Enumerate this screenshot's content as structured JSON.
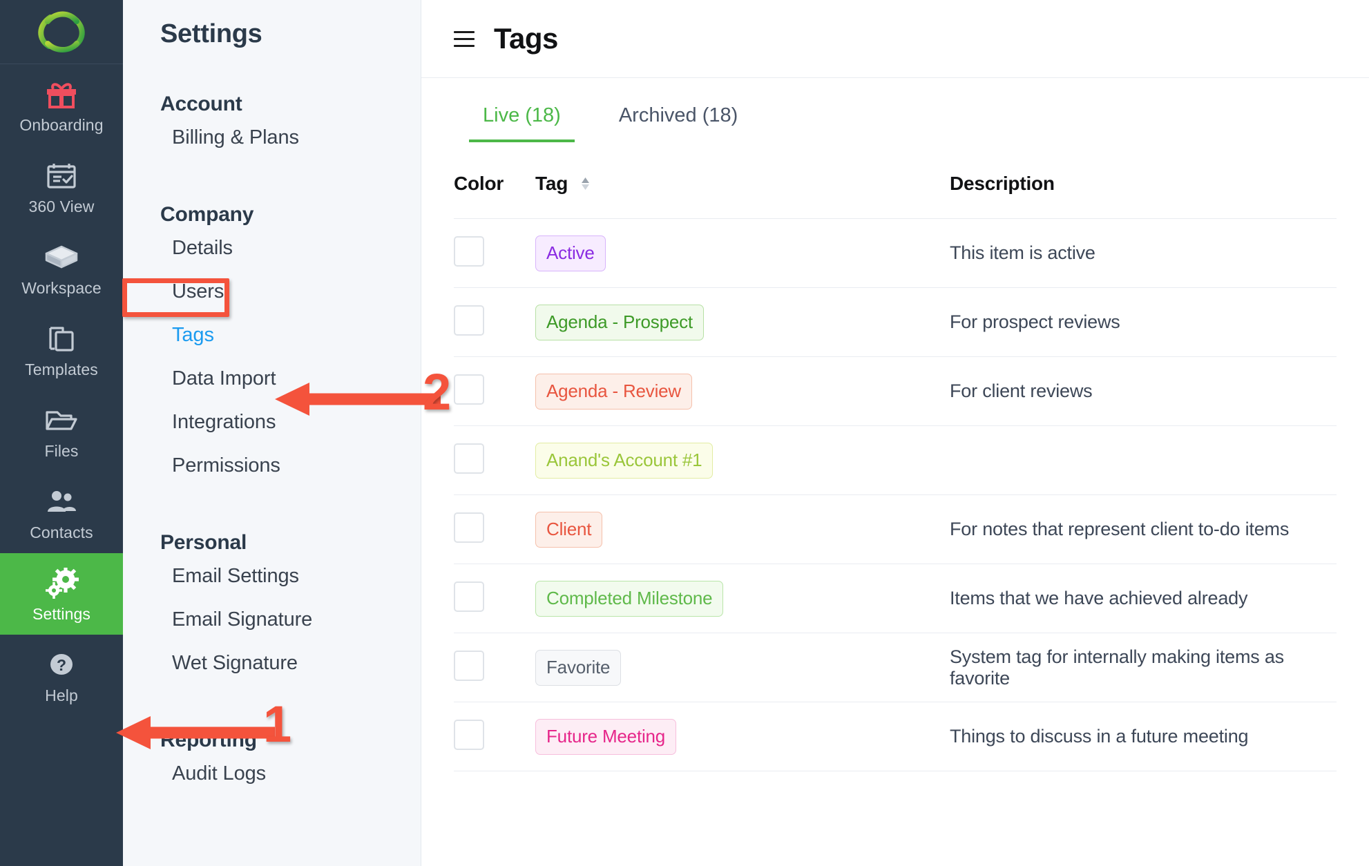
{
  "rail": {
    "logo_name": "company-logo",
    "items": [
      {
        "label": "Onboarding",
        "icon": "gift-icon",
        "active": false
      },
      {
        "label": "360 View",
        "icon": "calendar-check-icon",
        "active": false
      },
      {
        "label": "Workspace",
        "icon": "box-icon",
        "active": false
      },
      {
        "label": "Templates",
        "icon": "copy-icon",
        "active": false
      },
      {
        "label": "Files",
        "icon": "folder-icon",
        "active": false
      },
      {
        "label": "Contacts",
        "icon": "people-icon",
        "active": false
      },
      {
        "label": "Settings",
        "icon": "gears-icon",
        "active": true
      },
      {
        "label": "Help",
        "icon": "question-circle-icon",
        "active": false
      }
    ]
  },
  "settings_nav": {
    "title": "Settings",
    "groups": [
      {
        "heading": "Account",
        "items": [
          {
            "label": "Billing & Plans",
            "selected": false
          }
        ]
      },
      {
        "heading": "Company",
        "items": [
          {
            "label": "Details",
            "selected": false
          },
          {
            "label": "Users",
            "selected": false
          },
          {
            "label": "Tags",
            "selected": true
          },
          {
            "label": "Data Import",
            "selected": false
          },
          {
            "label": "Integrations",
            "selected": false
          },
          {
            "label": "Permissions",
            "selected": false
          }
        ]
      },
      {
        "heading": "Personal",
        "items": [
          {
            "label": "Email Settings",
            "selected": false
          },
          {
            "label": "Email Signature",
            "selected": false
          },
          {
            "label": "Wet Signature",
            "selected": false
          }
        ]
      },
      {
        "heading": "Reporting",
        "items": [
          {
            "label": "Audit Logs",
            "selected": false
          }
        ]
      }
    ]
  },
  "main": {
    "menu_icon": "hamburger-icon",
    "title": "Tags",
    "tabs": [
      {
        "label": "Live (18)",
        "active": true
      },
      {
        "label": "Archived (18)",
        "active": false
      }
    ],
    "table": {
      "columns": [
        "Color",
        "Tag",
        "Description"
      ],
      "sort_icon": "sort-arrows-icon",
      "rows": [
        {
          "swatch": "#9b3ff5",
          "tag": "Active",
          "pill_text": "#8a2be2",
          "pill_bg": "#f7ecff",
          "pill_border": "#d8b4fb",
          "description": "This item is active"
        },
        {
          "swatch": "#40a928",
          "tag": "Agenda - Prospect",
          "pill_text": "#3d9a27",
          "pill_bg": "#f1faec",
          "pill_border": "#b7e0a5",
          "description": "For prospect reviews"
        },
        {
          "swatch": "#f4566a",
          "tag": "Agenda - Review",
          "pill_text": "#e8553f",
          "pill_bg": "#fdefe9",
          "pill_border": "#f5c0ab",
          "description": "For client reviews"
        },
        {
          "swatch": "#9ef93f",
          "tag": "Anand's Account #1",
          "pill_text": "#9ac63a",
          "pill_bg": "#fbfde9",
          "pill_border": "#e2eda3",
          "description": ""
        },
        {
          "swatch": "#f4566a",
          "tag": "Client",
          "pill_text": "#e8553f",
          "pill_bg": "#fdefe9",
          "pill_border": "#f5c0ab",
          "description": "For notes that represent client to-do items"
        },
        {
          "swatch": "#40a928",
          "tag": "Completed Milestone",
          "pill_text": "#5fb94a",
          "pill_bg": "#f2fbee",
          "pill_border": "#b9e5a9",
          "description": "Items that we have achieved already"
        },
        {
          "swatch": "#ffffff",
          "tag": "Favorite",
          "pill_text": "#555e6b",
          "pill_bg": "#f7f8fa",
          "pill_border": "#dcdfe4",
          "description": "System tag for internally making items as favorite"
        },
        {
          "swatch": "#ee2a8c",
          "tag": "Future Meeting",
          "pill_text": "#e6268a",
          "pill_bg": "#fdedf5",
          "pill_border": "#f7bedc",
          "description": "Things to discuss in a future meeting"
        },
        {
          "swatch": "#40a928",
          "tag": "",
          "pill_text": "#3d9a27",
          "pill_bg": "#f1faec",
          "pill_border": "#b7e0a5",
          "description": ""
        }
      ]
    }
  },
  "annotations": {
    "step1_number": "1",
    "step2_number": "2",
    "accent_color": "#f4533c"
  }
}
